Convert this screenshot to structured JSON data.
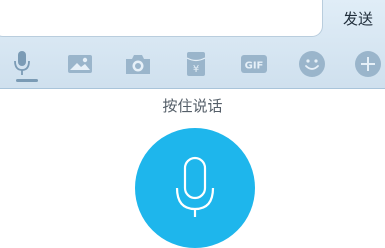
{
  "composer": {
    "input_value": "",
    "send_label": "发送"
  },
  "toolbar": {
    "items": [
      {
        "icon": "microphone-icon",
        "active": true
      },
      {
        "icon": "image-icon"
      },
      {
        "icon": "camera-icon"
      },
      {
        "icon": "red-packet-icon",
        "label": "¥"
      },
      {
        "icon": "gif-icon",
        "label": "GIF"
      },
      {
        "icon": "emoji-icon"
      },
      {
        "icon": "plus-icon"
      }
    ]
  },
  "voice_panel": {
    "hint": "按住说话",
    "accent_color": "#1eb6ec"
  }
}
